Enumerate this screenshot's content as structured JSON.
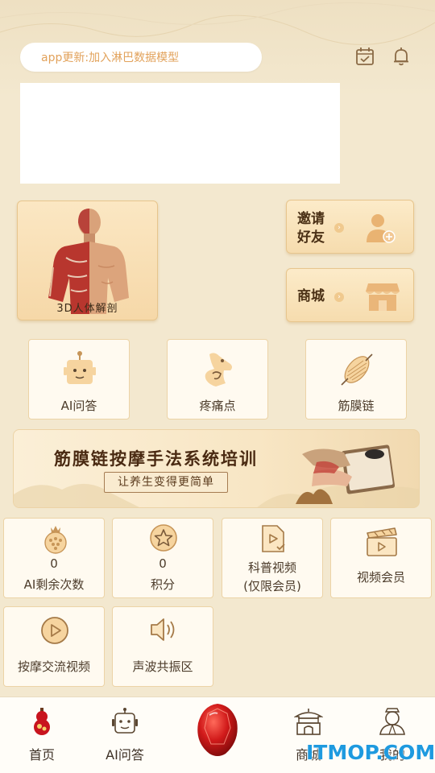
{
  "header": {
    "search_placeholder": "app更新:加入淋巴数据模型"
  },
  "tiles": {
    "anatomy_label": "3D人体解剖",
    "invite_line1": "邀请",
    "invite_line2": "好友",
    "shop_label": "商城"
  },
  "quick": [
    {
      "label": "AI问答"
    },
    {
      "label": "疼痛点"
    },
    {
      "label": "筋膜链"
    }
  ],
  "course_banner": {
    "title": "筋膜链按摩手法系统培训",
    "subtitle": "让养生变得更简单"
  },
  "grid": [
    {
      "line1": "0",
      "line2": "AI剩余次数"
    },
    {
      "line1": "0",
      "line2": "积分"
    },
    {
      "line1": "科普视频",
      "line2": "(仅限会员)"
    },
    {
      "line1": "视频会员"
    },
    {
      "line1": "按摩交流视频"
    },
    {
      "line1": "声波共振区"
    }
  ],
  "nav": [
    {
      "label": "首页"
    },
    {
      "label": "AI问答"
    },
    {
      "label": "商城"
    },
    {
      "label": "我的"
    }
  ],
  "watermark": "ITMOP.COM",
  "colors": {
    "background": "#f3e8cf",
    "accent": "#e2a25b",
    "card_border": "#ecd3a6",
    "nav_active": "#c8141e"
  }
}
